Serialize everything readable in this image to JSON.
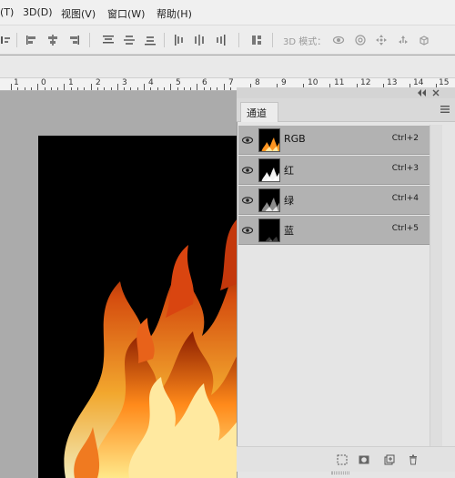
{
  "menu": {
    "items": [
      "(T)",
      "3D(D)",
      "视图(V)",
      "窗口(W)",
      "帮助(H)"
    ]
  },
  "options_bar": {
    "mode_label": "3D 模式："
  },
  "ruler": {
    "labels": [
      "1",
      "0",
      "1",
      "2",
      "3",
      "4",
      "5",
      "6",
      "7",
      "8",
      "9",
      "10",
      "11",
      "12",
      "13",
      "14",
      "15"
    ]
  },
  "panel": {
    "tab_label": "通道",
    "channels": [
      {
        "name": "RGB",
        "shortcut": "Ctrl+2",
        "thumb": "color"
      },
      {
        "name": "红",
        "shortcut": "Ctrl+3",
        "thumb": "bright"
      },
      {
        "name": "绿",
        "shortcut": "Ctrl+4",
        "thumb": "mid"
      },
      {
        "name": "蓝",
        "shortcut": "Ctrl+5",
        "thumb": "dark"
      }
    ]
  },
  "colors": {
    "flame_core": "#fff2a8",
    "flame_mid": "#ffa01e",
    "flame_outer": "#d9480f"
  }
}
